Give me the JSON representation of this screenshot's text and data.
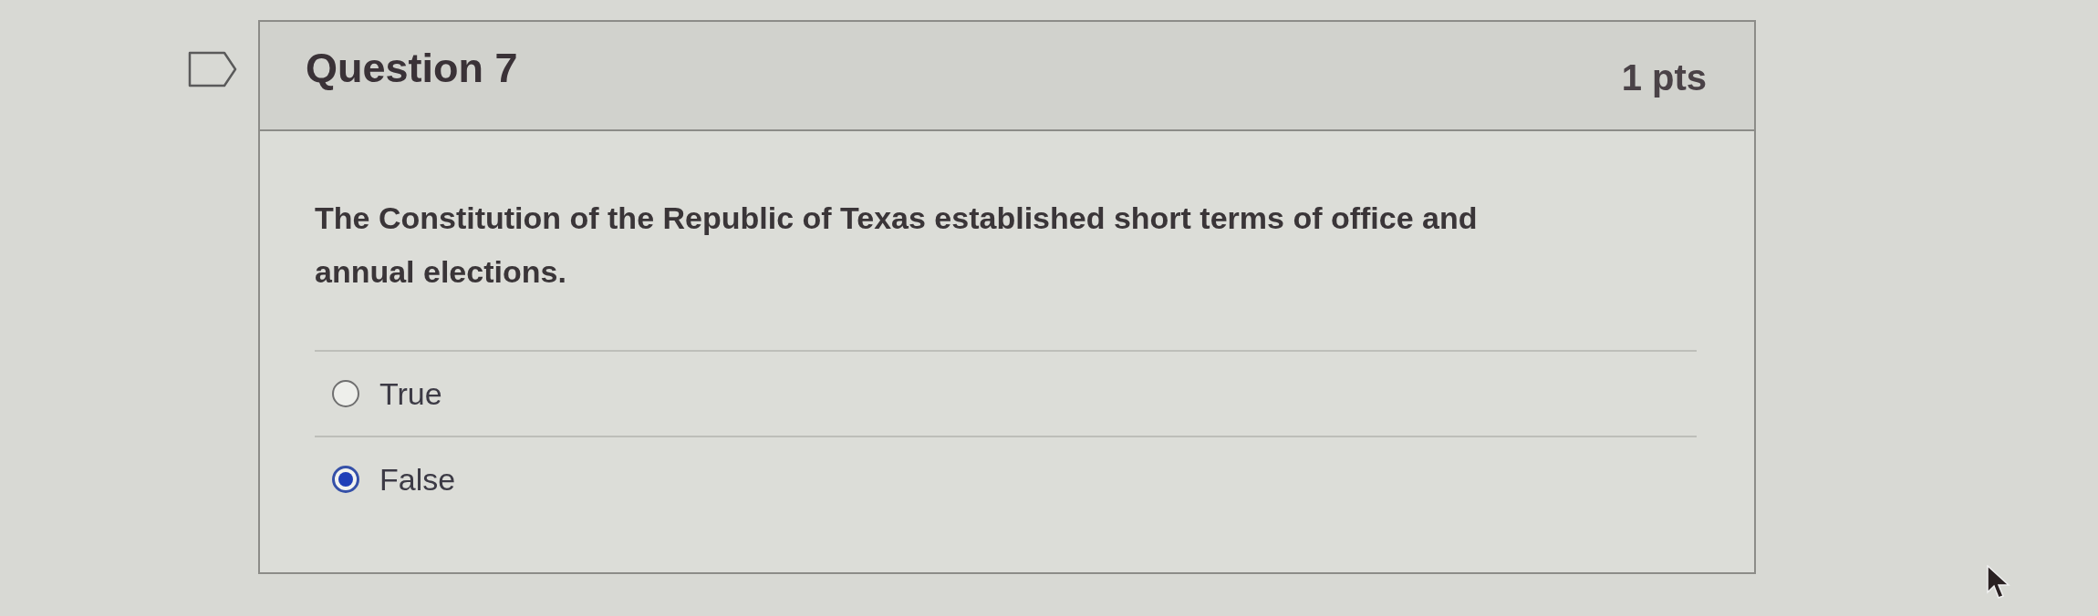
{
  "question": {
    "title": "Question 7",
    "points": "1 pts",
    "text": "The Constitution of the Republic of Texas established short terms of office and annual elections.",
    "answers": [
      {
        "label": "True",
        "selected": false
      },
      {
        "label": "False",
        "selected": true
      }
    ]
  }
}
